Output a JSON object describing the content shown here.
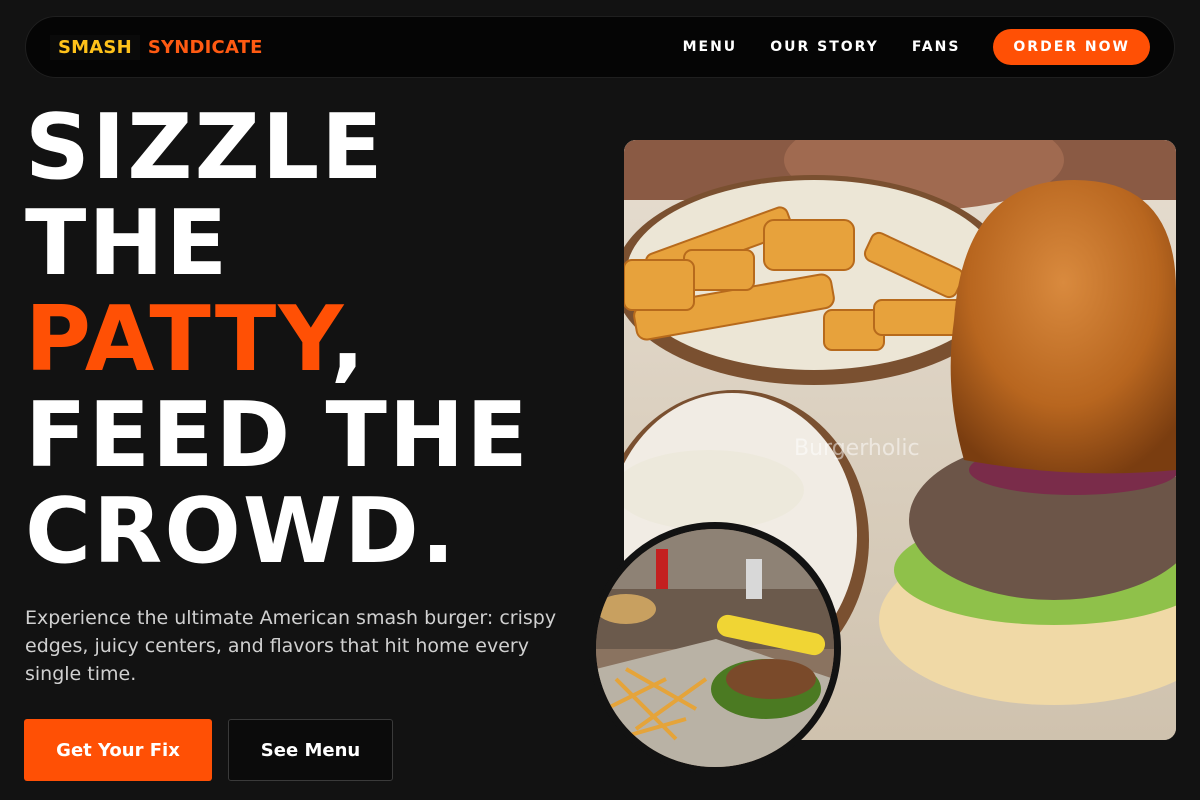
{
  "brand": {
    "part1": "SMASH",
    "part2": "SYNDICATE"
  },
  "nav": {
    "links": [
      "MENU",
      "OUR STORY",
      "FANS"
    ],
    "cta": "ORDER NOW"
  },
  "hero": {
    "line1": "SIZZLE",
    "line2": "THE",
    "line3_accent": "PATTY",
    "line3_rest": ",",
    "line4": "FEED THE",
    "line5": "CROWD.",
    "subtext": "Experience the ultimate American smash burger: crispy edges, juicy centers, and flavors that hit home every single time.",
    "primary_button": "Get Your Fix",
    "secondary_button": "See Menu",
    "watermark": "Burgerholic"
  },
  "colors": {
    "background": "#121212",
    "accent": "#ff5005",
    "logo_yellow": "#ffc21a"
  },
  "images": {
    "main": "burger-with-fries-photo",
    "inset": "diner-table-burger-fries-photo"
  }
}
